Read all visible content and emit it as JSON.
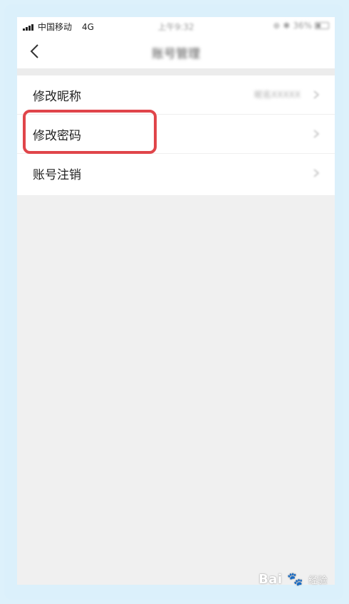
{
  "status_bar": {
    "carrier": "中国移动",
    "network": "4G",
    "time": "上午9:32",
    "battery": "36%"
  },
  "nav": {
    "title": "账号管理",
    "back_icon": "chevron-left-icon"
  },
  "settings": {
    "items": [
      {
        "label": "修改昵称",
        "value": "昵名XXXXX"
      },
      {
        "label": "修改密码",
        "value": ""
      },
      {
        "label": "账号注销",
        "value": ""
      }
    ]
  },
  "highlight_color": "#e0454a",
  "watermark": {
    "text": "Bai",
    "suffix": "经验"
  }
}
